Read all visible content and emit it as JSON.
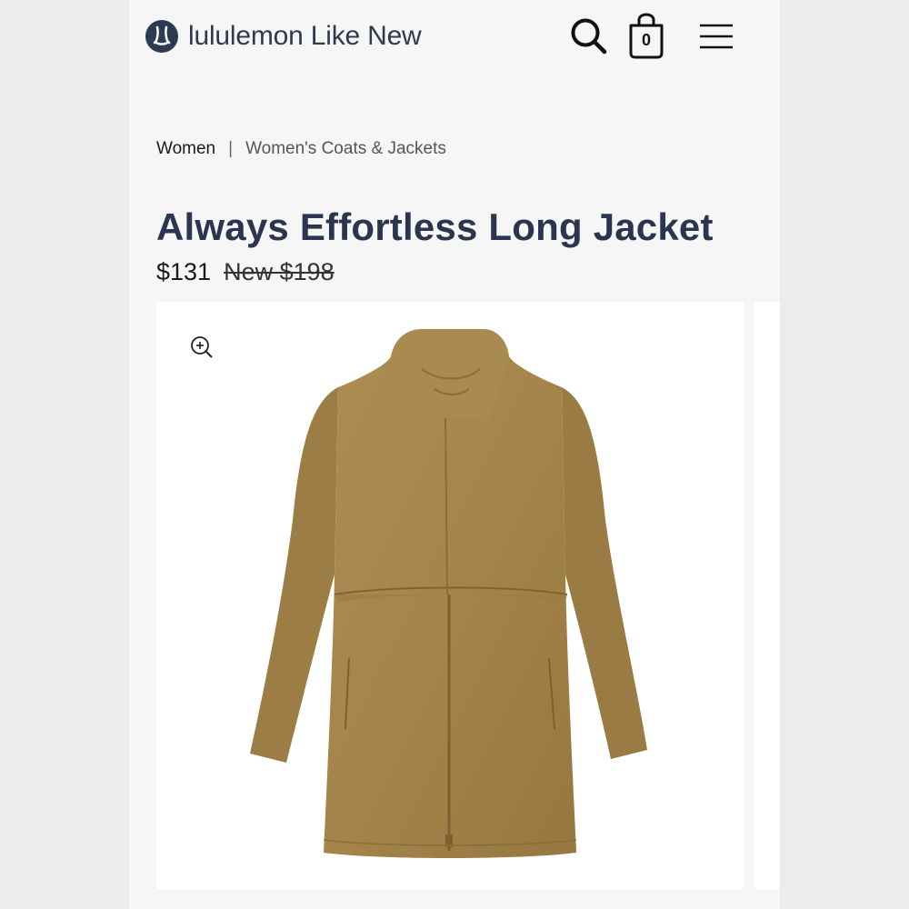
{
  "header": {
    "brand_name": "lululemon Like New",
    "logo_icon": "lululemon-logo-icon",
    "search_icon": "search-icon",
    "bag_icon": "shopping-bag-icon",
    "bag_count": "0",
    "menu_icon": "hamburger-menu-icon"
  },
  "breadcrumb": {
    "category": "Women",
    "separator": "|",
    "subcategory": "Women's Coats & Jackets"
  },
  "product": {
    "title": "Always Effortless Long Jacket",
    "price": "$131",
    "original_price": "New $198",
    "image_alt_icon": "jacket-product-image",
    "zoom_icon": "zoom-in-icon",
    "colors": {
      "jacket": "#a4844a",
      "title": "#2a3650"
    }
  }
}
